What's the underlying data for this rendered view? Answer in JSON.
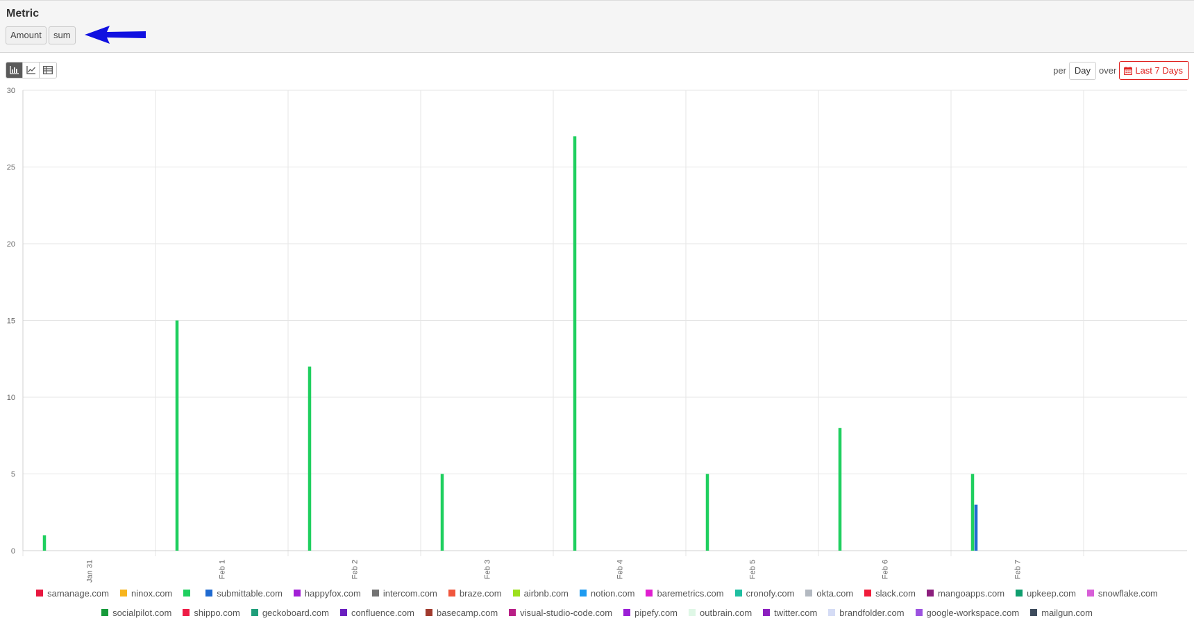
{
  "metric": {
    "title": "Metric",
    "field_label": "Amount",
    "aggregation_label": "sum",
    "arrow_color": "#1010e0"
  },
  "toolbar": {
    "views": [
      {
        "name": "bar-chart-view",
        "icon": "bar-chart-icon",
        "active": true
      },
      {
        "name": "line-chart-view",
        "icon": "line-chart-icon",
        "active": false
      },
      {
        "name": "table-view",
        "icon": "table-icon",
        "active": false
      }
    ],
    "per_label": "per",
    "interval_value": "Day",
    "over_label": "over",
    "range_value": "Last 7 Days",
    "range_icon": "calendar-icon",
    "accent_color": "#e0201e"
  },
  "chart_data": {
    "type": "bar",
    "categories": [
      "Jan 31",
      "Feb 1",
      "Feb 2",
      "Feb 3",
      "Feb 4",
      "Feb 5",
      "Feb 6",
      "Feb 7"
    ],
    "ylim": [
      0,
      30
    ],
    "yticks": [
      0,
      5,
      10,
      15,
      20,
      25,
      30
    ],
    "grid": true,
    "legend_position": "bottom",
    "series": [
      {
        "name": "",
        "color": "#1fcf5f",
        "values": [
          1,
          15,
          12,
          5,
          27,
          5,
          8,
          5
        ]
      },
      {
        "name": "submittable.com",
        "color": "#1f6ad0",
        "values": [
          0,
          0,
          0,
          0,
          0,
          0,
          0,
          3
        ]
      }
    ]
  },
  "legend": {
    "items": [
      {
        "label": "samanage.com",
        "color": "#e8173f"
      },
      {
        "label": "ninox.com",
        "color": "#f7b51e"
      },
      {
        "label": "",
        "color": "#1fcf5f"
      },
      {
        "label": "submittable.com",
        "color": "#1f6ad0"
      },
      {
        "label": "happyfox.com",
        "color": "#a21fd6"
      },
      {
        "label": "intercom.com",
        "color": "#737373"
      },
      {
        "label": "braze.com",
        "color": "#f0563d"
      },
      {
        "label": "airbnb.com",
        "color": "#9de01d"
      },
      {
        "label": "notion.com",
        "color": "#1e9bf0"
      },
      {
        "label": "baremetrics.com",
        "color": "#e01fd0"
      },
      {
        "label": "cronofy.com",
        "color": "#1fbfa1"
      },
      {
        "label": "okta.com",
        "color": "#b3b9c1"
      },
      {
        "label": "slack.com",
        "color": "#f01c3a"
      },
      {
        "label": "mangoapps.com",
        "color": "#8c1f7d"
      },
      {
        "label": "upkeep.com",
        "color": "#0f9e6e"
      },
      {
        "label": "snowflake.com",
        "color": "#d85ed8"
      },
      {
        "label": "socialpilot.com",
        "color": "#169a3a"
      },
      {
        "label": "shippo.com",
        "color": "#ee1c46"
      },
      {
        "label": "geckoboard.com",
        "color": "#1f9e7a"
      },
      {
        "label": "confluence.com",
        "color": "#6a1fbf"
      },
      {
        "label": "basecamp.com",
        "color": "#a13b2e"
      },
      {
        "label": "visual-studio-code.com",
        "color": "#b81f86"
      },
      {
        "label": "pipefy.com",
        "color": "#9b1fd6"
      },
      {
        "label": "outbrain.com",
        "color": "#dff7e6"
      },
      {
        "label": "twitter.com",
        "color": "#8c1fbf"
      },
      {
        "label": "brandfolder.com",
        "color": "#d5dcf5"
      },
      {
        "label": "google-workspace.com",
        "color": "#9c52e0"
      },
      {
        "label": "mailgun.com",
        "color": "#3d4b5c"
      }
    ]
  }
}
